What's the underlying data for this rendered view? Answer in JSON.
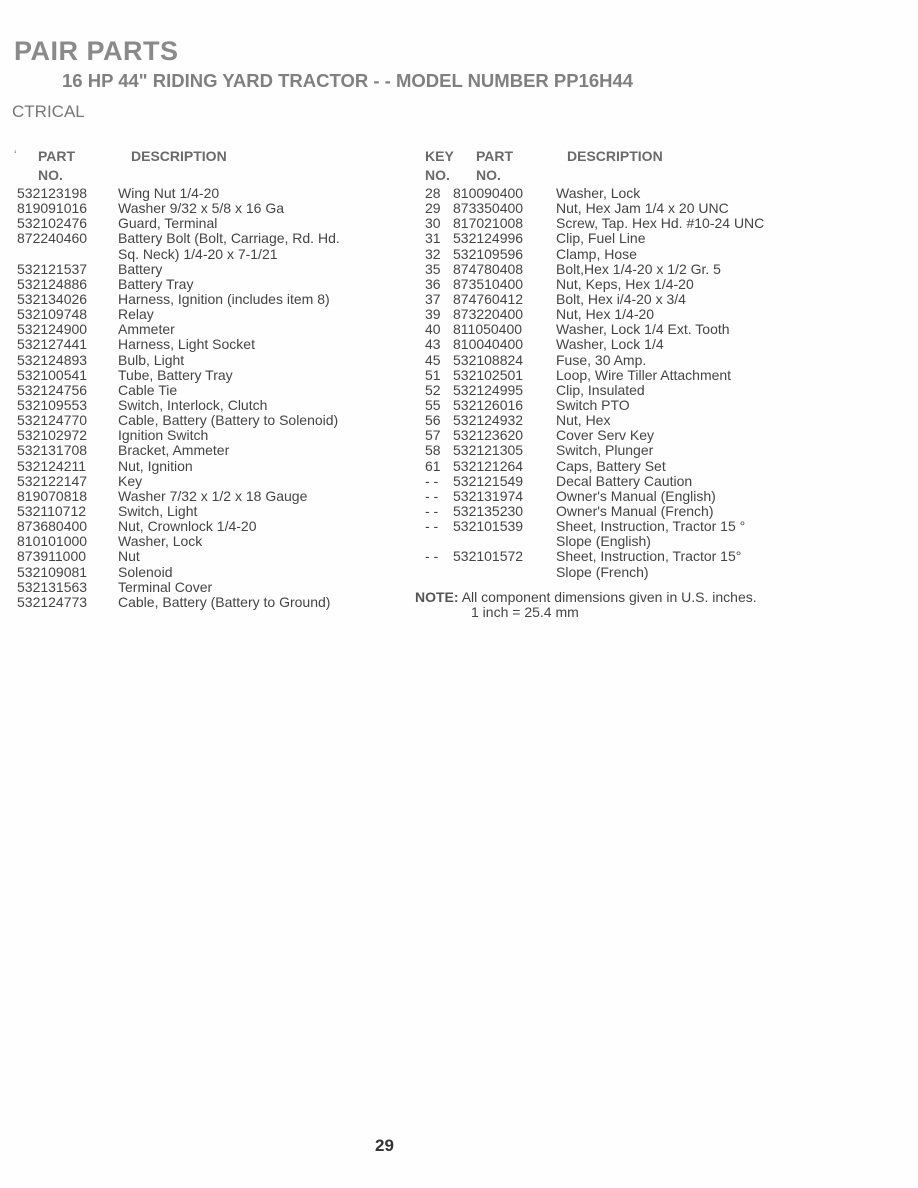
{
  "header": {
    "title": "PAIR PARTS",
    "subtitle": "16 HP 44\" RIDING YARD TRACTOR - - MODEL NUMBER PP16H44",
    "section": "CTRICAL"
  },
  "left_table": {
    "headers": {
      "part_no": [
        "PART",
        "NO."
      ],
      "description": "DESCRIPTION"
    },
    "rows": [
      {
        "part": "532123198",
        "desc": [
          "Wing Nut  1/4-20"
        ]
      },
      {
        "part": "819091016",
        "desc": [
          "Washer  9/32 x 5/8 x 16 Ga"
        ]
      },
      {
        "part": "532102476",
        "desc": [
          "Guard, Terminal"
        ]
      },
      {
        "part": "872240460",
        "desc": [
          "Battery Bolt (Bolt, Carriage, Rd. Hd.",
          "Sq. Neck)  1/4-20 x 7-1/21"
        ]
      },
      {
        "part": "532121537",
        "desc": [
          "Battery"
        ]
      },
      {
        "part": "532124886",
        "desc": [
          "Battery Tray"
        ]
      },
      {
        "part": "532134026",
        "desc": [
          "Harness, Ignition (includes item 8)"
        ]
      },
      {
        "part": "532109748",
        "desc": [
          "Relay"
        ]
      },
      {
        "part": "532124900",
        "desc": [
          "Ammeter"
        ]
      },
      {
        "part": "532127441",
        "desc": [
          "Harness, Light Socket"
        ]
      },
      {
        "part": "532124893",
        "desc": [
          "Bulb, Light"
        ]
      },
      {
        "part": "532100541",
        "desc": [
          "Tube, Battery Tray"
        ]
      },
      {
        "part": "532124756",
        "desc": [
          "Cable Tie"
        ]
      },
      {
        "part": "532109553",
        "desc": [
          "Switch, Interlock, Clutch"
        ]
      },
      {
        "part": "532124770",
        "desc": [
          "Cable, Battery (Battery to Solenoid)"
        ]
      },
      {
        "part": "532102972",
        "desc": [
          "Ignition Switch"
        ]
      },
      {
        "part": "532131708",
        "desc": [
          "Bracket, Ammeter"
        ]
      },
      {
        "part": "532124211",
        "desc": [
          "Nut, Ignition"
        ]
      },
      {
        "part": "532122147",
        "desc": [
          "Key"
        ]
      },
      {
        "part": "819070818",
        "desc": [
          "Washer  7/32 x 1/2 x 18 Gauge"
        ]
      },
      {
        "part": "532110712",
        "desc": [
          "Switch, Light"
        ]
      },
      {
        "part": "873680400",
        "desc": [
          "Nut, Crownlock  1/4-20"
        ]
      },
      {
        "part": "810101000",
        "desc": [
          "Washer, Lock"
        ]
      },
      {
        "part": "873911000",
        "desc": [
          "Nut"
        ]
      },
      {
        "part": "532109081",
        "desc": [
          "Solenoid"
        ]
      },
      {
        "part": "532131563",
        "desc": [
          "Terminal Cover"
        ]
      },
      {
        "part": "532124773",
        "desc": [
          "Cable, Battery (Battery to Ground)"
        ]
      }
    ]
  },
  "right_table": {
    "headers": {
      "key_no": [
        "KEY",
        "NO."
      ],
      "part_no": [
        "PART",
        "NO."
      ],
      "description": "DESCRIPTION"
    },
    "rows": [
      {
        "key": "28",
        "part": "810090400",
        "desc": [
          "Washer, Lock"
        ]
      },
      {
        "key": "29",
        "part": "873350400",
        "desc": [
          "Nut, Hex Jam  1/4 x 20 UNC"
        ]
      },
      {
        "key": "30",
        "part": "817021008",
        "desc": [
          "Screw, Tap. Hex Hd. #10-24 UNC"
        ]
      },
      {
        "key": "31",
        "part": "532124996",
        "desc": [
          "Clip, Fuel Line"
        ]
      },
      {
        "key": "32",
        "part": "532109596",
        "desc": [
          "Clamp, Hose"
        ]
      },
      {
        "key": "35",
        "part": "874780408",
        "desc": [
          "Bolt,Hex  1/4-20 x 1/2 Gr. 5"
        ]
      },
      {
        "key": "36",
        "part": "873510400",
        "desc": [
          "Nut, Keps, Hex  1/4-20"
        ]
      },
      {
        "key": "37",
        "part": "874760412",
        "desc": [
          "Bolt, Hex  i/4-20 x 3/4"
        ]
      },
      {
        "key": "39",
        "part": "873220400",
        "desc": [
          "Nut, Hex  1/4-20"
        ]
      },
      {
        "key": "40",
        "part": "811050400",
        "desc": [
          "Washer, Lock  1/4 Ext. Tooth"
        ]
      },
      {
        "key": "43",
        "part": "810040400",
        "desc": [
          "Washer, Lock  1/4"
        ]
      },
      {
        "key": "45",
        "part": "532108824",
        "desc": [
          "Fuse, 30 Amp."
        ]
      },
      {
        "key": "51",
        "part": "532102501",
        "desc": [
          "Loop, Wire Tiller Attachment"
        ]
      },
      {
        "key": "52",
        "part": "532124995",
        "desc": [
          "Clip, Insulated"
        ]
      },
      {
        "key": "55",
        "part": "532126016",
        "desc": [
          "Switch PTO"
        ]
      },
      {
        "key": "56",
        "part": "532124932",
        "desc": [
          "Nut, Hex"
        ]
      },
      {
        "key": "57",
        "part": "532123620",
        "desc": [
          "Cover Serv Key"
        ]
      },
      {
        "key": "58",
        "part": "532121305",
        "desc": [
          "Switch, Plunger"
        ]
      },
      {
        "key": "61",
        "part": "532121264",
        "desc": [
          "Caps, Battery Set"
        ]
      },
      {
        "key": "- -",
        "part": "532121549",
        "desc": [
          "Decal Battery Caution"
        ]
      },
      {
        "key": "- -",
        "part": "532131974",
        "desc": [
          "Owner's Manual (English)"
        ]
      },
      {
        "key": "- -",
        "part": "532135230",
        "desc": [
          "Owner's Manual (French)"
        ]
      },
      {
        "key": "- -",
        "part": "532101539",
        "desc": [
          "Sheet, Instruction, Tractor 15 °",
          "Slope (English)"
        ]
      },
      {
        "key": "- -",
        "part": "532101572",
        "desc": [
          "Sheet, Instruction, Tractor 15°",
          "Slope (French)"
        ]
      }
    ]
  },
  "note": {
    "label": "NOTE:",
    "line1": "All component dimensions given in U.S. inches.",
    "line2": "1 inch = 25.4 mm"
  },
  "page_number": "29"
}
